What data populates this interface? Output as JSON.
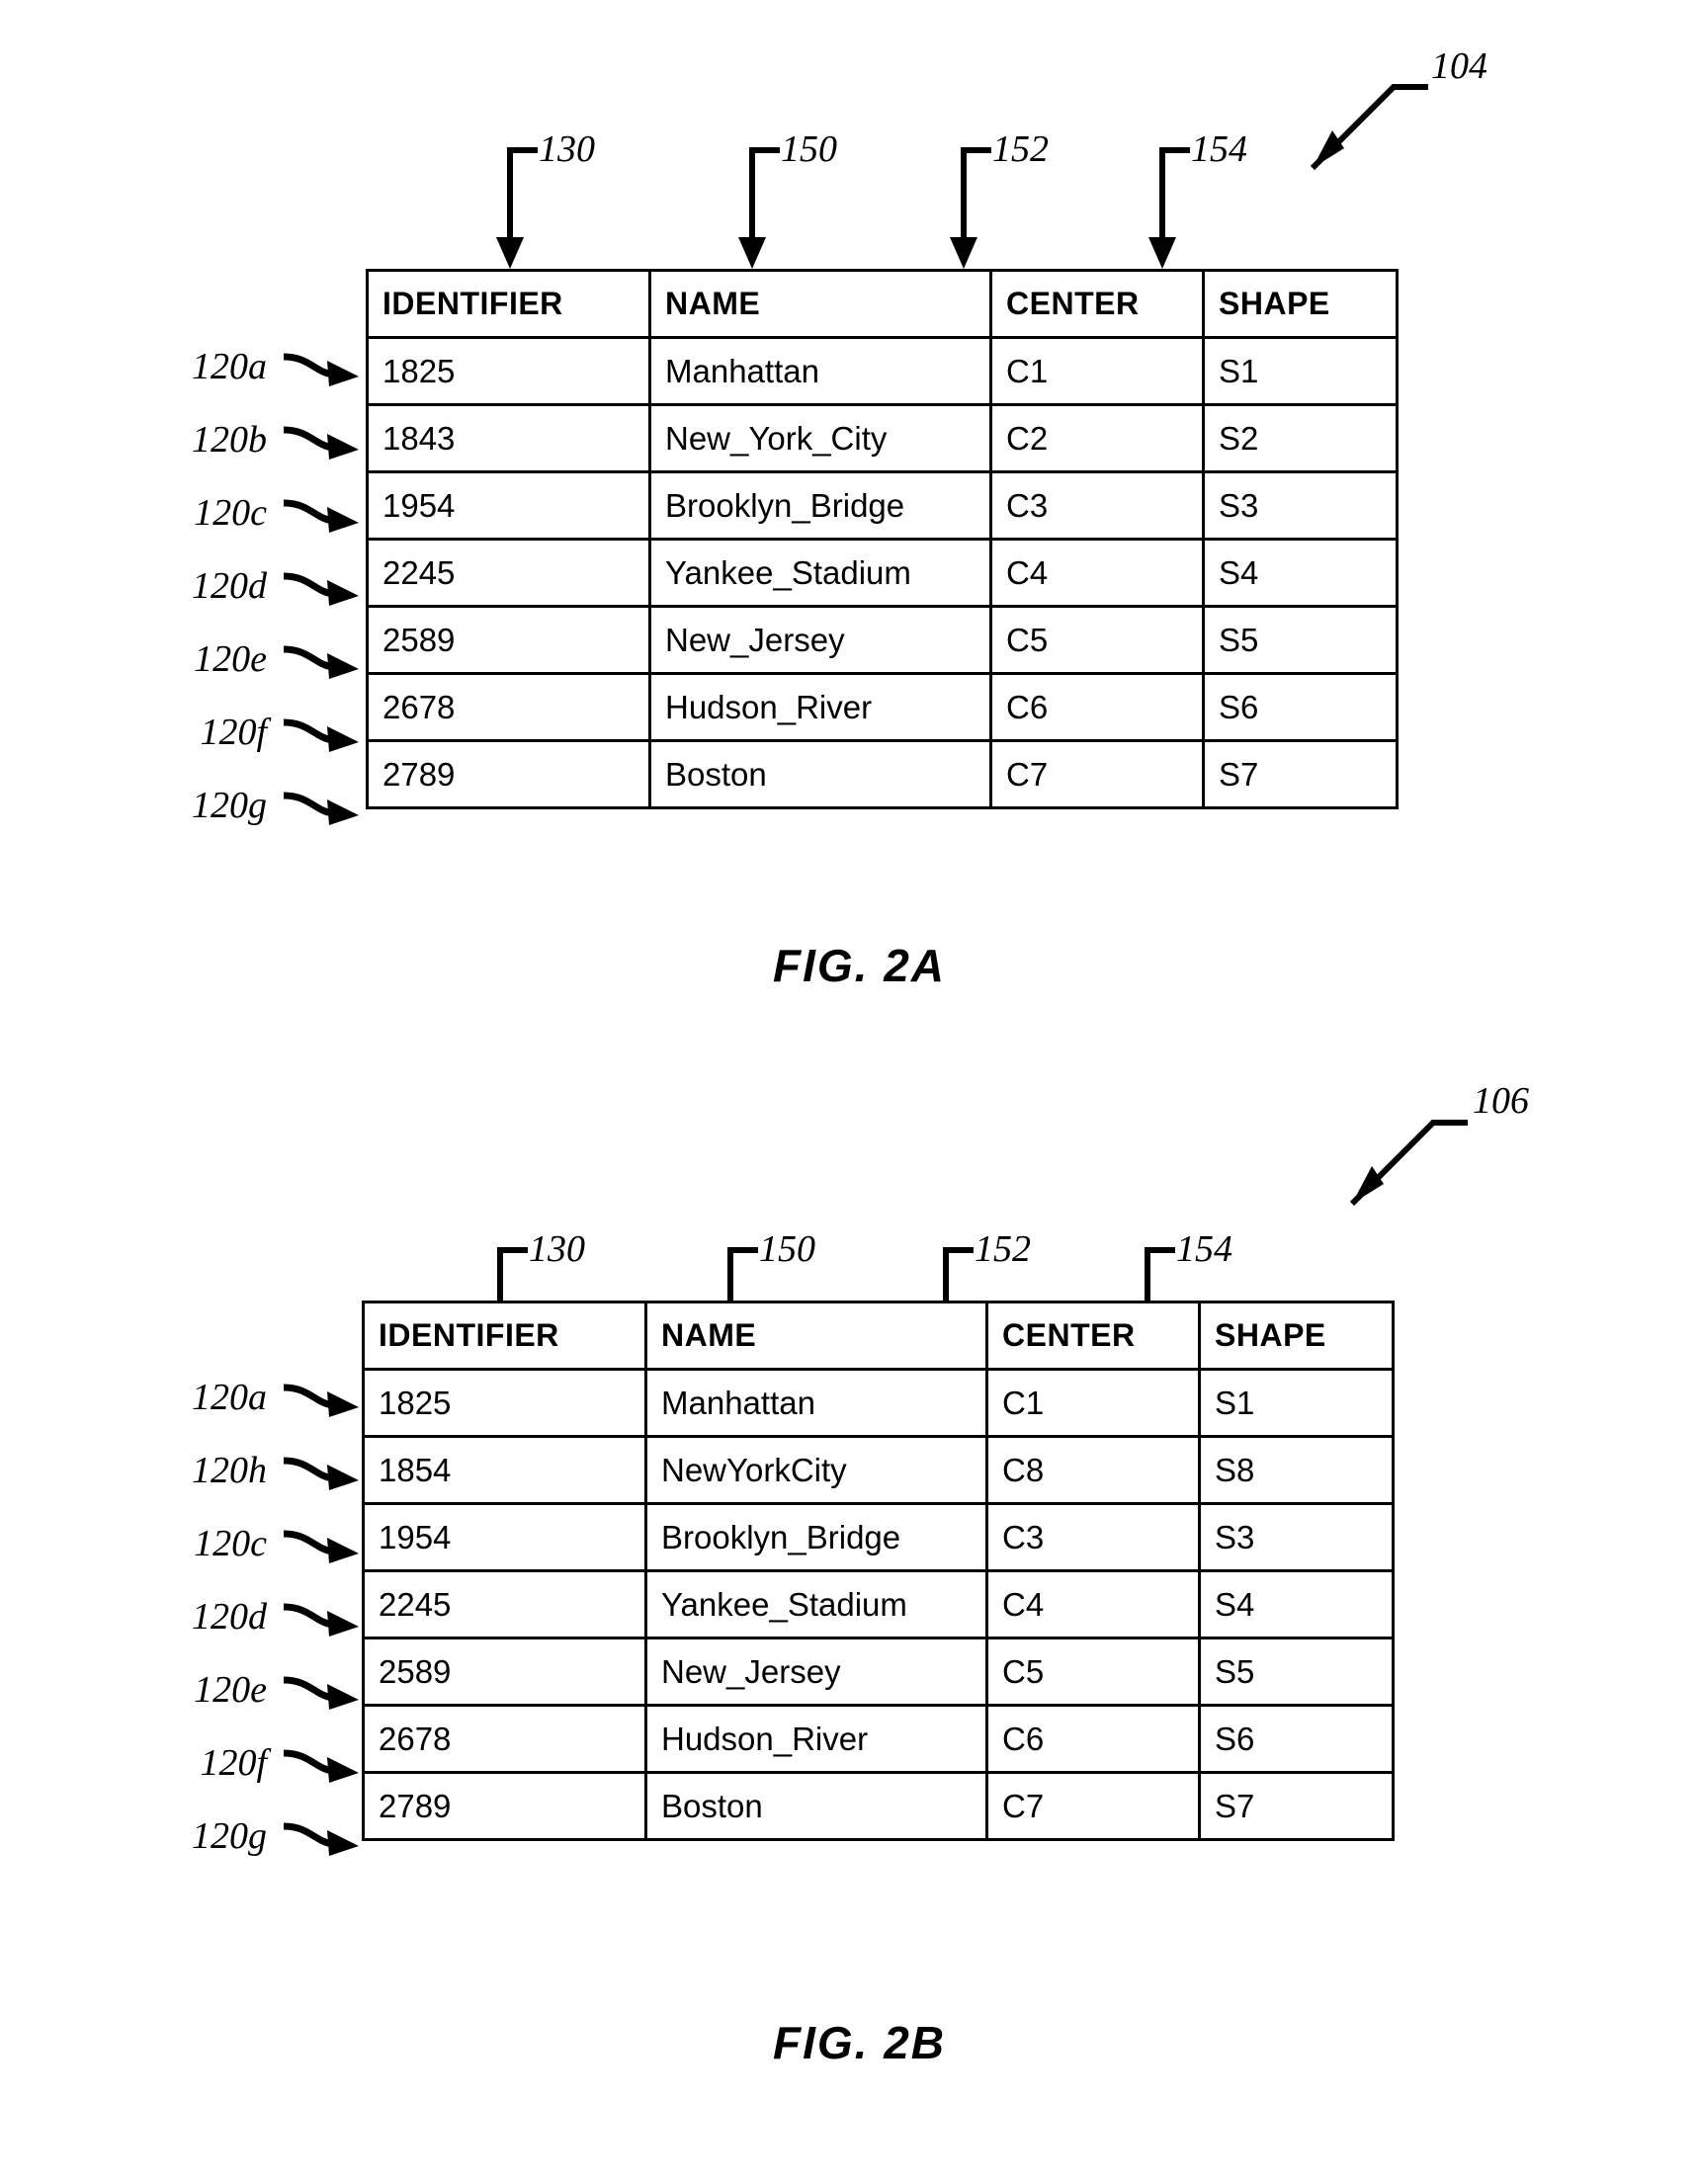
{
  "figures": [
    {
      "id": "fig-2a",
      "caption": "FIG. 2A",
      "table_ref": "104",
      "column_refs": [
        "130",
        "150",
        "152",
        "154"
      ],
      "row_refs": [
        "120a",
        "120b",
        "120c",
        "120d",
        "120e",
        "120f",
        "120g"
      ],
      "table": {
        "columns": [
          "IDENTIFIER",
          "NAME",
          "CENTER",
          "SHAPE"
        ],
        "rows": [
          [
            "1825",
            "Manhattan",
            "C1",
            "S1"
          ],
          [
            "1843",
            "New_York_City",
            "C2",
            "S2"
          ],
          [
            "1954",
            "Brooklyn_Bridge",
            "C3",
            "S3"
          ],
          [
            "2245",
            "Yankee_Stadium",
            "C4",
            "S4"
          ],
          [
            "2589",
            "New_Jersey",
            "C5",
            "S5"
          ],
          [
            "2678",
            "Hudson_River",
            "C6",
            "S6"
          ],
          [
            "2789",
            "Boston",
            "C7",
            "S7"
          ]
        ]
      }
    },
    {
      "id": "fig-2b",
      "caption": "FIG. 2B",
      "table_ref": "106",
      "column_refs": [
        "130",
        "150",
        "152",
        "154"
      ],
      "row_refs": [
        "120a",
        "120h",
        "120c",
        "120d",
        "120e",
        "120f",
        "120g"
      ],
      "table": {
        "columns": [
          "IDENTIFIER",
          "NAME",
          "CENTER",
          "SHAPE"
        ],
        "rows": [
          [
            "1825",
            "Manhattan",
            "C1",
            "S1"
          ],
          [
            "1854",
            "NewYorkCity",
            "C8",
            "S8"
          ],
          [
            "1954",
            "Brooklyn_Bridge",
            "C3",
            "S3"
          ],
          [
            "2245",
            "Yankee_Stadium",
            "C4",
            "S4"
          ],
          [
            "2589",
            "New_Jersey",
            "C5",
            "S5"
          ],
          [
            "2678",
            "Hudson_River",
            "C6",
            "S6"
          ],
          [
            "2789",
            "Boston",
            "C7",
            "S7"
          ]
        ]
      }
    }
  ],
  "colors": {
    "ink": "#000000",
    "paper": "#ffffff"
  }
}
